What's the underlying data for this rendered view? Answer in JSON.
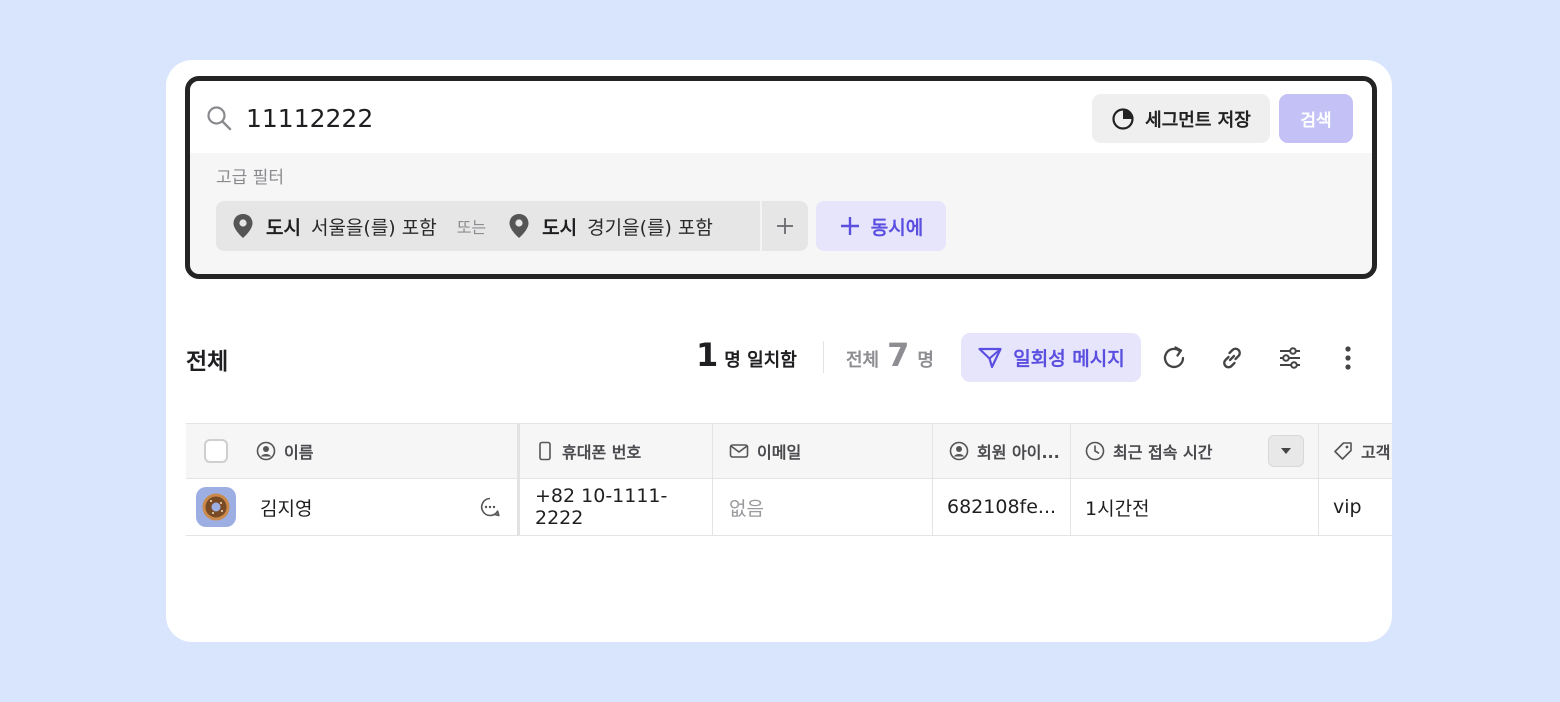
{
  "search": {
    "query": "11112222",
    "save_segment_label": "세그먼트 저장",
    "search_button_label": "검색"
  },
  "advanced_filter": {
    "label": "고급 필터",
    "conditions": [
      {
        "field": "도시",
        "condition": "서울을(를) 포함"
      },
      {
        "field": "도시",
        "condition": "경기을(를) 포함"
      }
    ],
    "or_label": "또는",
    "and_button_label": "동시에"
  },
  "toolbar": {
    "title": "전체",
    "match_count": "1",
    "match_label": "명 일치함",
    "total_label": "전체",
    "total_count": "7",
    "total_unit": "명",
    "message_button_label": "일회성 메시지"
  },
  "table": {
    "headers": {
      "name": "이름",
      "phone": "휴대폰 번호",
      "email": "이메일",
      "member_id": "회원 아이...",
      "last_access": "최근 접속 시간",
      "customer": "고객"
    },
    "rows": [
      {
        "name": "김지영",
        "phone": "+82 10-1111-2222",
        "email": "없음",
        "member_id": "682108fe...",
        "last_access": "1시간전",
        "customer": "vip"
      }
    ]
  },
  "colors": {
    "accent": "#5b4fe0",
    "accent_bg": "#e6e5fb",
    "search_button_bg": "#c3c1f6",
    "page_bg": "#d8e5fd"
  }
}
